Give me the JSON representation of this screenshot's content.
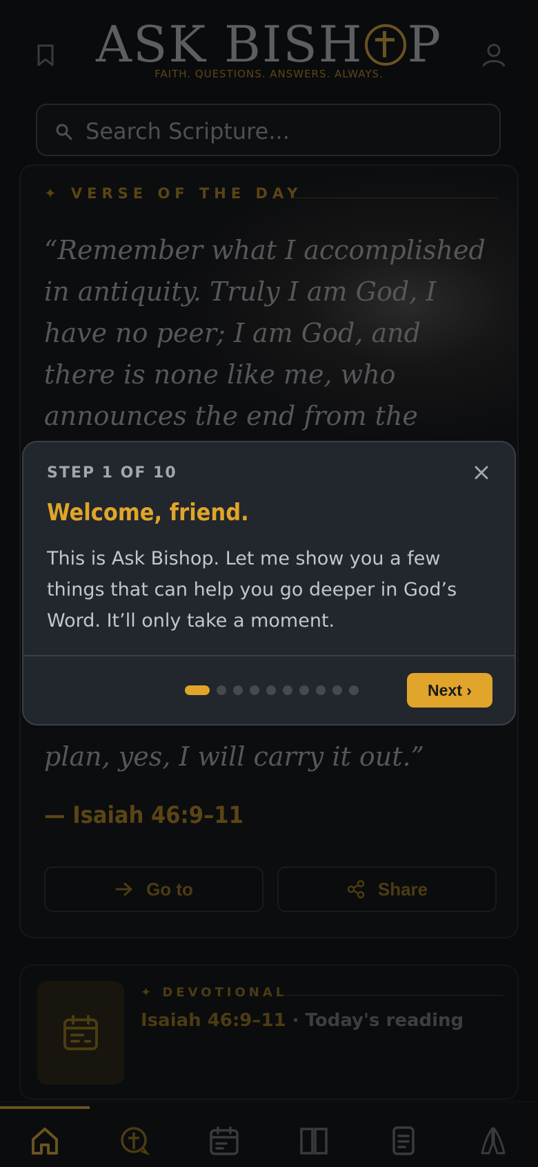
{
  "header": {
    "logo_left": "ASK BISH",
    "logo_right": "P",
    "tagline": "FAITH. QUESTIONS. ANSWERS. ALWAYS."
  },
  "search": {
    "placeholder": "Search Scripture..."
  },
  "verse_card": {
    "label": "✦ VERSE OF THE DAY",
    "text": "“Remember what I accomplished in antiquity. Truly I am God, I have no peer; I am God, and there is none like me, who announces the end from the beginning and reveals beforehand",
    "text_tail": "plan, yes, I will carry it out.”",
    "reference": "— Isaiah 46:9–11",
    "goto_label": "Go to",
    "share_label": "Share"
  },
  "devotional": {
    "label": "✦ DEVOTIONAL",
    "title": "Isaiah 46:9–11",
    "subtitle": " · Today's reading"
  },
  "bottom_nav": {
    "items": [
      "home-icon",
      "ask-icon",
      "calendar-icon",
      "bible-icon",
      "notes-icon",
      "prayer-icon"
    ],
    "active_index": 0
  },
  "tour_dialog": {
    "step": "STEP 1 OF 10",
    "title": "Welcome, friend.",
    "body": "This is Ask Bishop. Let me show you a few things that can help you go deeper in God’s Word. It’ll only take a moment.",
    "next_label": "Next ›",
    "total_steps": 10,
    "current_step": 1
  },
  "colors": {
    "accent": "#e0a52a",
    "dialog_bg": "#22262d",
    "page_bg": "#0a0b0d"
  }
}
